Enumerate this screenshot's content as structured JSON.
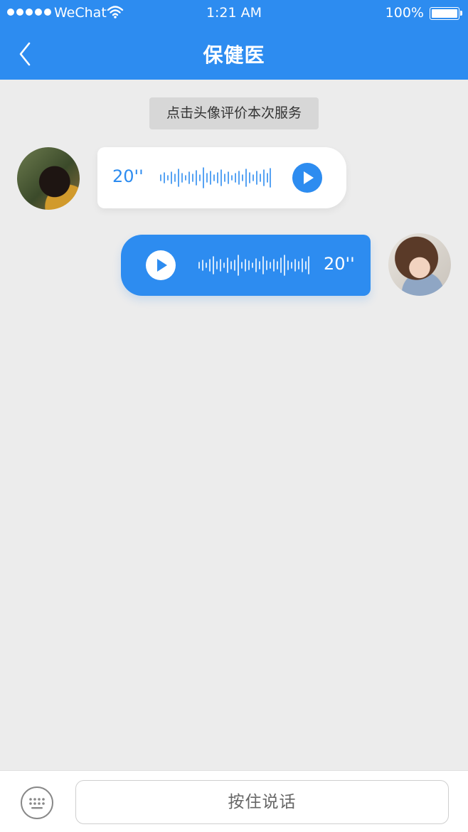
{
  "status_bar": {
    "carrier": "WeChat",
    "time": "1:21 AM",
    "battery": "100%"
  },
  "nav": {
    "title": "保健医",
    "back_icon": "chevron-left-icon"
  },
  "notice": "点击头像评价本次服务",
  "messages": [
    {
      "side": "left",
      "sender": "doctor",
      "type": "voice",
      "duration": "20''"
    },
    {
      "side": "right",
      "sender": "user",
      "type": "voice",
      "duration": "20''"
    }
  ],
  "input_bar": {
    "keyboard_icon": "keyboard-icon",
    "talk_label": "按住说话"
  },
  "colors": {
    "brand": "#2d8cf0",
    "background": "#ececec",
    "notice_bg": "#d7d7d7"
  }
}
